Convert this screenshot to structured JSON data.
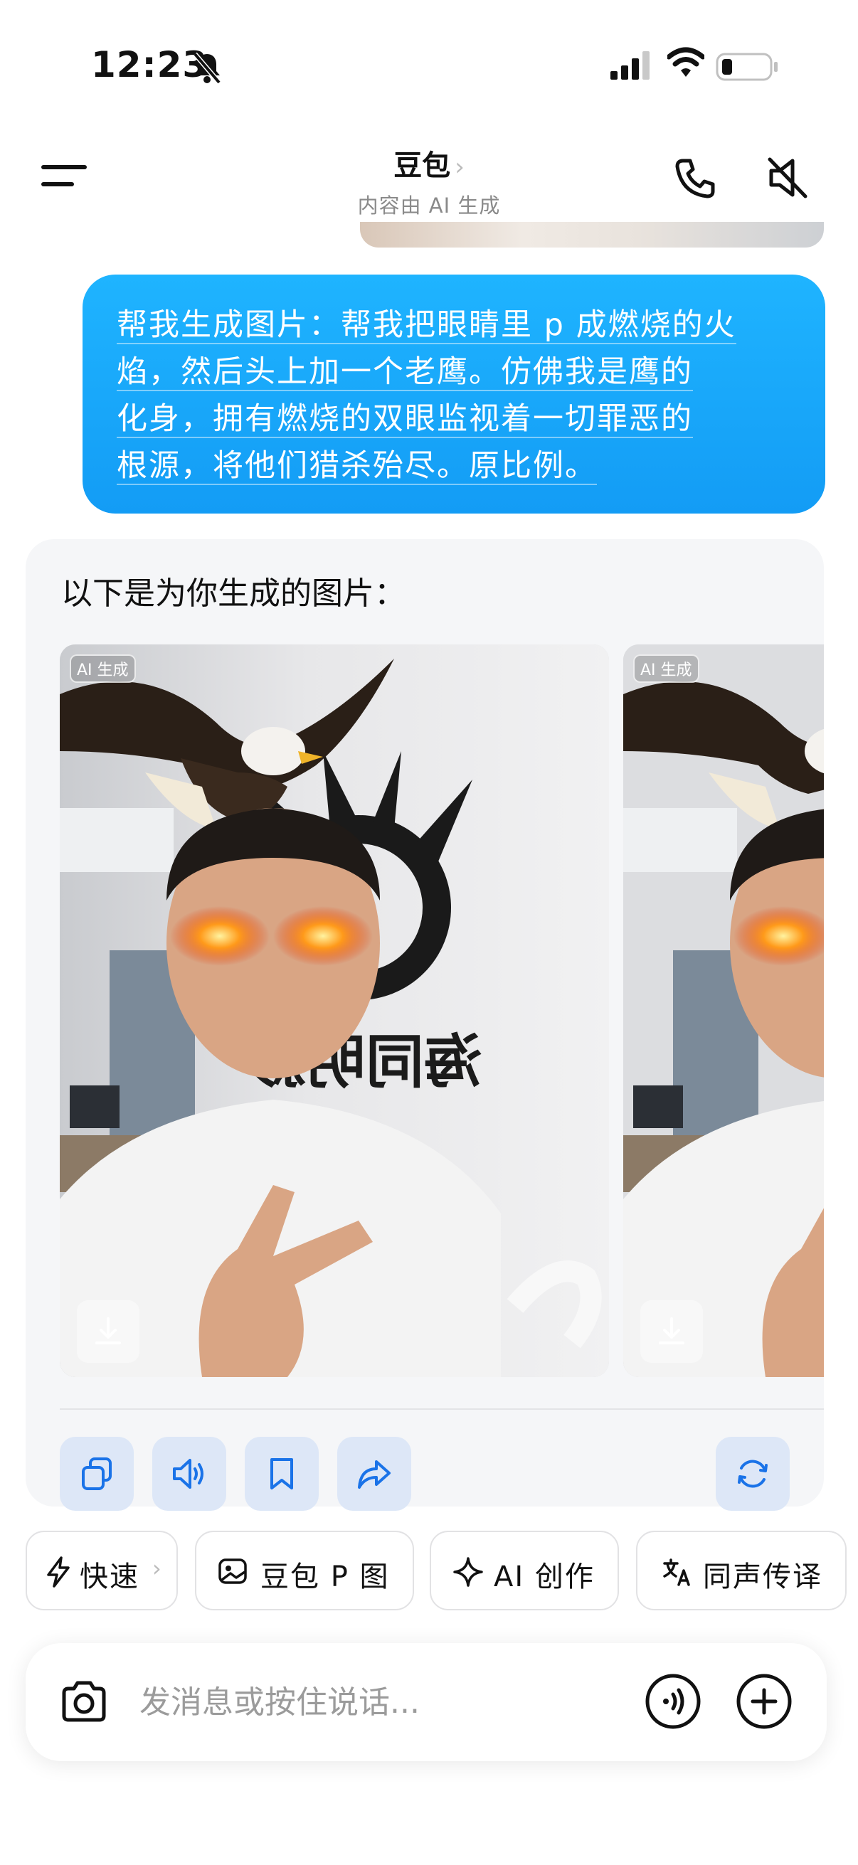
{
  "status_bar": {
    "time": "12:23"
  },
  "header": {
    "title": "豆包",
    "title_chevron": "›",
    "subtitle": "内容由 AI 生成",
    "icons": [
      "menu-icon",
      "phone-icon",
      "speaker-mute-icon"
    ]
  },
  "user_message": {
    "lines": [
      "帮我生成图片：帮我把眼睛里 p 成燃烧的火",
      "焰，然后头上加一个老鹰。仿佛我是鹰的",
      "化身，拥有燃烧的双眼监视着一切罪恶的",
      "根源，将他们猎杀殆尽。原比例。"
    ]
  },
  "assistant": {
    "intro": "以下是为你生成的图片：",
    "images": [
      {
        "badge": "AI 生成",
        "wall_sign": "海同明影"
      },
      {
        "badge": "AI 生成"
      }
    ],
    "actions": [
      "copy-icon",
      "speaker-icon",
      "bookmark-icon",
      "share-icon",
      "regenerate-icon"
    ]
  },
  "chips": [
    {
      "label": "快速",
      "chevron": "›",
      "icon": "lightning-icon"
    },
    {
      "label": "豆包 P 图",
      "icon": "image-edit-icon"
    },
    {
      "label": "AI 创作",
      "icon": "sparkle-icon"
    },
    {
      "label": "同声传译",
      "icon": "translate-icon"
    }
  ],
  "input": {
    "placeholder": "发消息或按住说话..."
  },
  "colors": {
    "bubble": "#139cf5",
    "action_bg": "#dde7f7",
    "action_icon": "#1a73e8"
  }
}
